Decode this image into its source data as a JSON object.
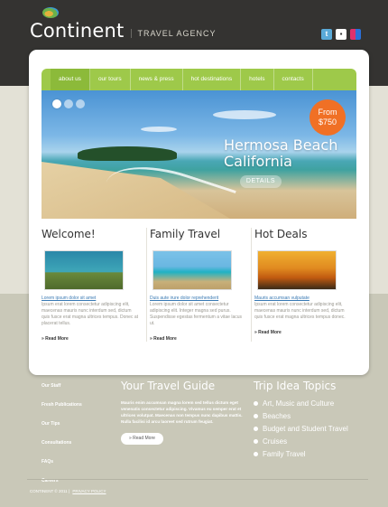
{
  "brand": {
    "name": "Continent",
    "tagline": "TRAVEL AGENCY"
  },
  "social": [
    "twitter-icon",
    "delicious-icon",
    "flickr-icon"
  ],
  "nav": [
    "about us",
    "our tours",
    "news & press",
    "hot destinations",
    "hotels",
    "contacts"
  ],
  "hero": {
    "price_from": "From",
    "price_value": "$750",
    "title_line1": "Hermosa Beach",
    "title_line2": "California",
    "button": "DETAILS",
    "slides": 3
  },
  "columns": [
    {
      "title": "Welcome!",
      "link": "Lorem ipsum dolor sit amet",
      "text": "Ipsum erat lorem consectetur adipiscing elit, maecenas mauris nunc interdum sed, dictum quis fusce erat magna ultrices tempus. Donec at placerat tellus.",
      "more": "» Read More"
    },
    {
      "title": "Family Travel",
      "link": "Duis aute irure dolor reprehenderit",
      "text": "Lorem ipsum dolor sit amet consectetur adipiscing elit. Integer magna sed purus. Suspendisse egestas fermentum a vitae lacus ut.",
      "more": "» Read More"
    },
    {
      "title": "Hot Deals",
      "link": "Mauris accumsan vulputate",
      "text": "Ipsum erat lorem consectetur adipiscing elit, maecenas mauris nunc interdum sed, dictum quis fusce erat magna ultrices tempus donec.",
      "more": "» Read More"
    }
  ],
  "footer_menu": [
    "Our Staff",
    "Fresh Publications",
    "Our Tips",
    "Consultations",
    "FAQs",
    "Careers"
  ],
  "guide": {
    "title": "Your Travel Guide",
    "text": "Mauris enim accumsan magna lorem sed tellus dictum eget venenatis consectetur adipiscing. Vivamus eu semper erat et ultrices volutpat. Maecenas non tempus nunc dapibus mattis. Nulla facilisi id arcu laoreet sed rutrum feugiat.",
    "button": "» Read More"
  },
  "trips": {
    "title": "Trip Idea Topics",
    "items": [
      "Art, Music and Culture",
      "Beaches",
      "Budget and Student Travel",
      "Cruises",
      "Family Travel"
    ]
  },
  "copyright": {
    "text": "CONTINENT © 2011 |",
    "policy": "PRIVACY POLICY"
  },
  "colors": {
    "header_bg": "#343331",
    "nav_bg": "#9ec94a",
    "price_badge": "#f07025",
    "footer_bg": "#c9c8b8"
  }
}
